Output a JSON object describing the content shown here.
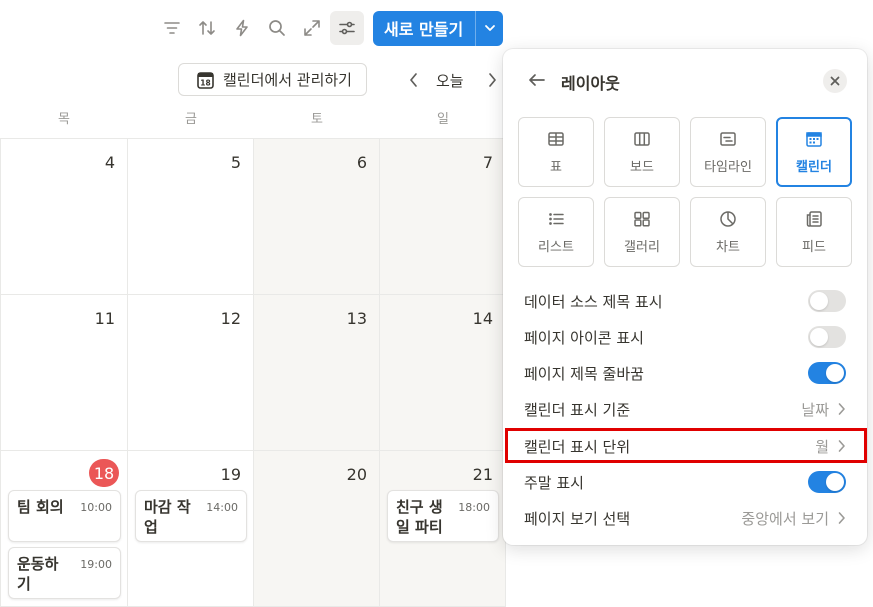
{
  "toolbar": {
    "icons": [
      "filter-icon",
      "sort-icon",
      "lightning-icon",
      "search-icon",
      "expand-icon",
      "settings-sliders-icon"
    ],
    "new_label": "새로 만들기"
  },
  "nav": {
    "manage_label": "캘린더에서 관리하기",
    "manage_icon_day": "18",
    "today_label": "오늘"
  },
  "calendar": {
    "weekdays": [
      "목",
      "금",
      "토",
      "일"
    ],
    "weeks": [
      [
        "4",
        "5",
        "6",
        "7"
      ],
      [
        "11",
        "12",
        "13",
        "14"
      ],
      [
        "18",
        "19",
        "20",
        "21"
      ]
    ],
    "today": "18",
    "events": {
      "e1": {
        "title": "팀 회의",
        "time": "10:00"
      },
      "e2": {
        "title": "운동하기",
        "time": "19:00"
      },
      "e3": {
        "title": "마감 작업",
        "time": "14:00"
      },
      "e4": {
        "title": "친구 생일 파티",
        "time": "18:00"
      }
    }
  },
  "panel": {
    "title": "레이아웃",
    "views": [
      {
        "label": "표",
        "icon": "table-icon"
      },
      {
        "label": "보드",
        "icon": "board-icon"
      },
      {
        "label": "타임라인",
        "icon": "timeline-icon"
      },
      {
        "label": "캘린더",
        "icon": "calendar-icon",
        "selected": true
      },
      {
        "label": "리스트",
        "icon": "list-icon"
      },
      {
        "label": "갤러리",
        "icon": "gallery-icon"
      },
      {
        "label": "차트",
        "icon": "chart-icon"
      },
      {
        "label": "피드",
        "icon": "feed-icon"
      }
    ],
    "options": {
      "show_source_title": {
        "label": "데이터 소스 제목 표시",
        "on": false
      },
      "show_page_icon": {
        "label": "페이지 아이콘 표시",
        "on": false
      },
      "wrap_page_title": {
        "label": "페이지 제목 줄바꿈",
        "on": true
      },
      "show_calendar_by": {
        "label": "캘린더 표시 기준",
        "value": "날짜"
      },
      "calendar_unit": {
        "label": "캘린더 표시 단위",
        "value": "월"
      },
      "show_weekends": {
        "label": "주말 표시",
        "on": true
      },
      "page_open_mode": {
        "label": "페이지 보기 선택",
        "value": "중앙에서 보기"
      }
    }
  },
  "colors": {
    "accent": "#2383e2",
    "today_badge": "#eb5757",
    "highlight": "#e00000"
  }
}
